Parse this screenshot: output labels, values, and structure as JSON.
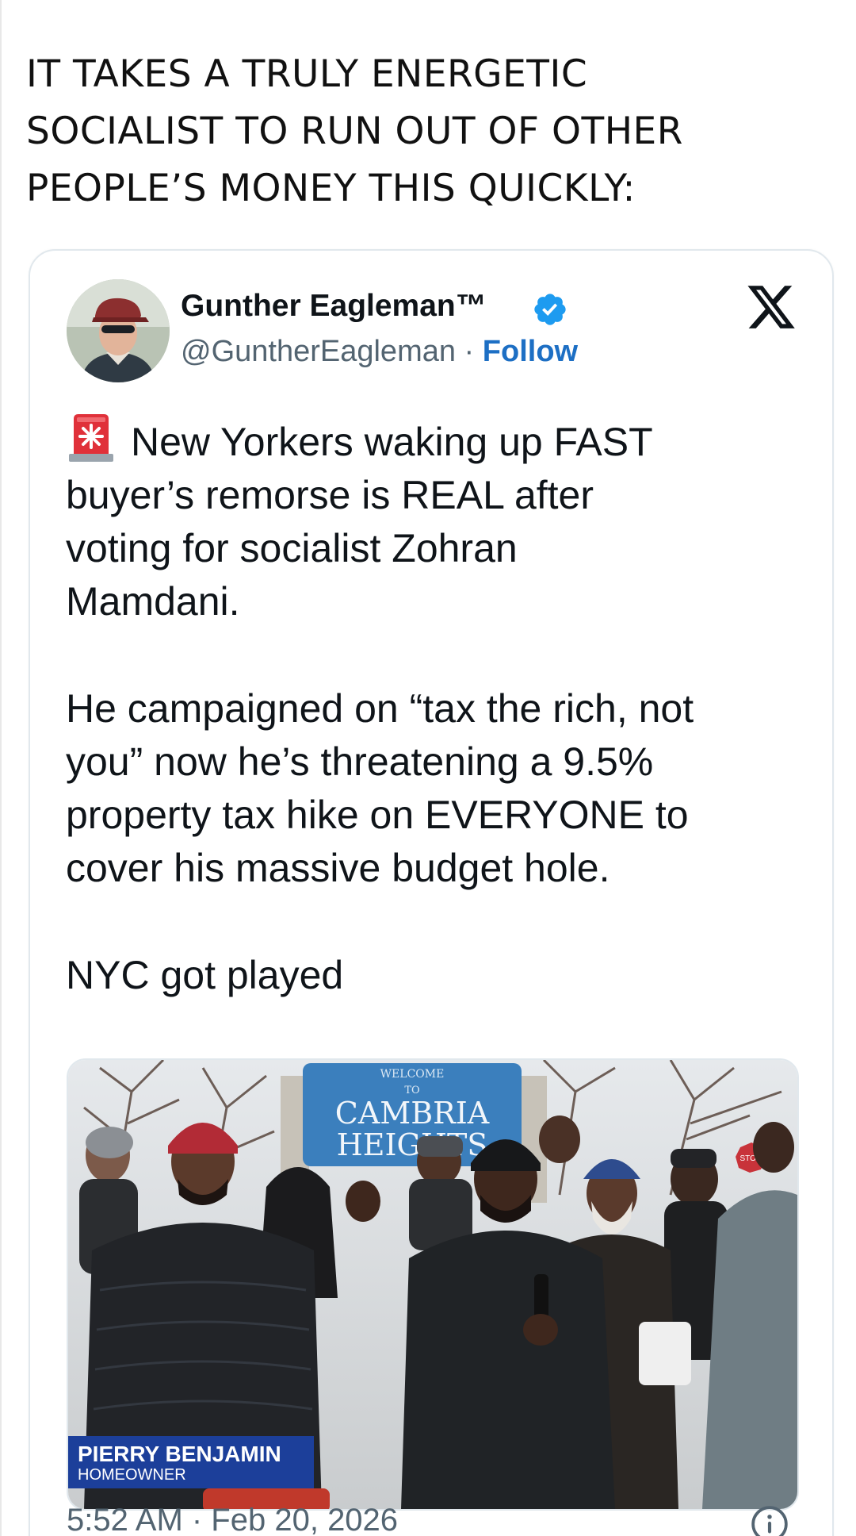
{
  "caption": {
    "lines": [
      "IT TAKES A TRULY ENERGETIC",
      "SOCIALIST TO RUN OUT OF OTHER",
      "PEOPLE’S MONEY THIS QUICKLY:"
    ]
  },
  "tweet": {
    "author_name": "Gunther Eagleman™",
    "handle": "@GuntherEagleman",
    "separator": " · ",
    "follow_label": "Follow",
    "platform_icon": "x-logo-icon",
    "verified_icon": "verified-badge-icon",
    "siren_icon": "siren-emoji-icon",
    "paragraphs": [
      {
        "lines": [
          "New Yorkers waking up FAST",
          "buyer’s remorse is REAL after",
          "voting for socialist Zohran",
          "Mamdani."
        ]
      },
      {
        "lines": [
          "He campaigned on “tax the rich, not",
          "you” now he’s threatening a 9.5%",
          "property tax hike on EVERYONE to",
          "cover his massive budget hole."
        ]
      },
      {
        "lines": [
          "NYC got played"
        ]
      }
    ],
    "media": {
      "sign_text_line1": "CAMBRIA",
      "sign_text_line2": "HEIGHTS",
      "stop_sign": "STOP",
      "lower_third_name": "PIERRY BENJAMIN",
      "lower_third_role": "HOMEOWNER"
    },
    "timestamp": "5:52 AM · Feb 20, 2026",
    "info_icon": "info-icon"
  },
  "colors": {
    "follow_blue": "#1d6fc4",
    "verified_blue": "#1d9bf0",
    "lower_third_blue": "#1c3f9a",
    "muted_text": "#536471"
  }
}
